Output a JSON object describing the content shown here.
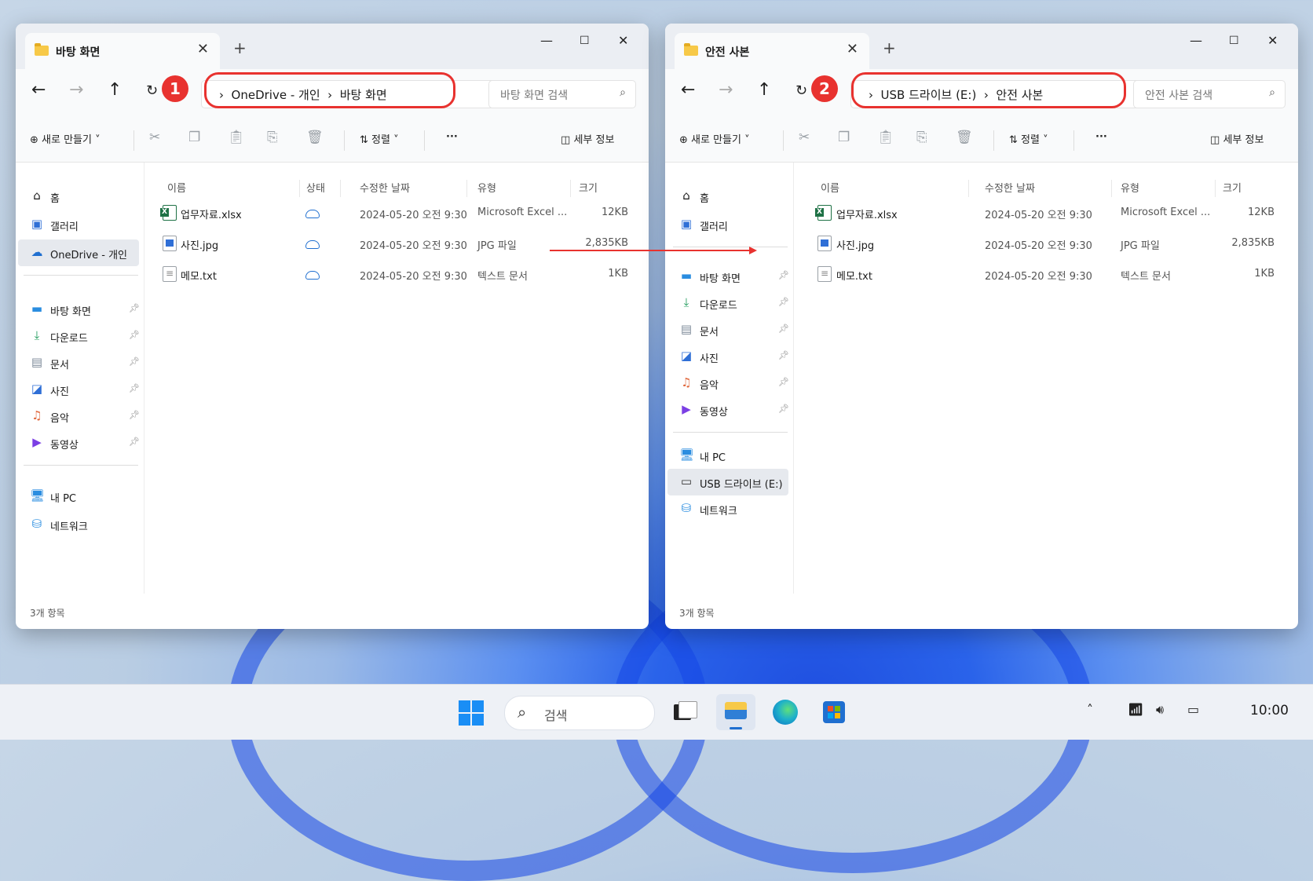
{
  "left_window": {
    "tab_title": "바탕 화면",
    "path": [
      "OneDrive - 개인",
      "바탕 화면"
    ],
    "search_placeholder": "바탕 화면 검색",
    "callout": "1",
    "toolbar": {
      "new": "새로 만들기",
      "sort": "정렬",
      "more": "···",
      "details": "세부 정보"
    },
    "sidebar": {
      "top": [
        {
          "icon": "home-icon",
          "label": "홈"
        },
        {
          "icon": "gallery-icon",
          "label": "갤러리"
        },
        {
          "icon": "onedrive-icon",
          "label": "OneDrive - 개인",
          "selected": true
        }
      ],
      "pinned": [
        {
          "icon": "desktop-icon",
          "label": "바탕 화면"
        },
        {
          "icon": "download-icon",
          "label": "다운로드"
        },
        {
          "icon": "documents-icon",
          "label": "문서"
        },
        {
          "icon": "pictures-icon",
          "label": "사진"
        },
        {
          "icon": "music-icon",
          "label": "음악"
        },
        {
          "icon": "videos-icon",
          "label": "동영상"
        }
      ],
      "bottom": [
        {
          "icon": "pc-icon",
          "label": "내 PC"
        },
        {
          "icon": "network-icon",
          "label": "네트워크"
        }
      ]
    },
    "columns": [
      "이름",
      "상태",
      "수정한 날짜",
      "유형",
      "크기"
    ],
    "files": [
      {
        "icon": "excel",
        "name": "업무자료.xlsx",
        "date": "2024-05-20 오전 9:30",
        "type": "Microsoft Excel ...",
        "size": "12KB"
      },
      {
        "icon": "image",
        "name": "사진.jpg",
        "date": "2024-05-20 오전 9:30",
        "type": "JPG 파일",
        "size": "2,835KB"
      },
      {
        "icon": "text",
        "name": "메모.txt",
        "date": "2024-05-20 오전 9:30",
        "type": "텍스트 문서",
        "size": "1KB"
      }
    ],
    "status": "3개 항목"
  },
  "right_window": {
    "tab_title": "안전 사본",
    "path": [
      "USB 드라이브 (E:)",
      "안전 사본"
    ],
    "search_placeholder": "안전 사본 검색",
    "callout": "2",
    "toolbar": {
      "new": "새로 만들기",
      "sort": "정렬",
      "more": "···",
      "details": "세부 정보"
    },
    "sidebar": {
      "top": [
        {
          "icon": "home-icon",
          "label": "홈"
        },
        {
          "icon": "gallery-icon",
          "label": "갤러리"
        }
      ],
      "pinned": [
        {
          "icon": "desktop-icon",
          "label": "바탕 화면"
        },
        {
          "icon": "download-icon",
          "label": "다운로드"
        },
        {
          "icon": "documents-icon",
          "label": "문서"
        },
        {
          "icon": "pictures-icon",
          "label": "사진"
        },
        {
          "icon": "music-icon",
          "label": "음악"
        },
        {
          "icon": "videos-icon",
          "label": "동영상"
        }
      ],
      "bottom": [
        {
          "icon": "pc-icon",
          "label": "내 PC"
        },
        {
          "icon": "usb-drive-icon",
          "label": "USB 드라이브 (E:)",
          "selected": true
        },
        {
          "icon": "network-icon",
          "label": "네트워크"
        }
      ]
    },
    "columns": [
      "이름",
      "수정한 날짜",
      "유형",
      "크기"
    ],
    "files": [
      {
        "icon": "excel",
        "name": "업무자료.xlsx",
        "date": "2024-05-20 오전 9:30",
        "type": "Microsoft Excel ...",
        "size": "12KB"
      },
      {
        "icon": "image",
        "name": "사진.jpg",
        "date": "2024-05-20 오전 9:30",
        "type": "JPG 파일",
        "size": "2,835KB"
      },
      {
        "icon": "text",
        "name": "메모.txt",
        "date": "2024-05-20 오전 9:30",
        "type": "텍스트 문서",
        "size": "1KB"
      }
    ],
    "status": "3개 항목"
  },
  "taskbar": {
    "search_label": "검색",
    "clock": "10:00"
  },
  "colors": {
    "highlight": "#e8322f",
    "accent": "#1f6fd0",
    "folder": "#f7c948"
  }
}
